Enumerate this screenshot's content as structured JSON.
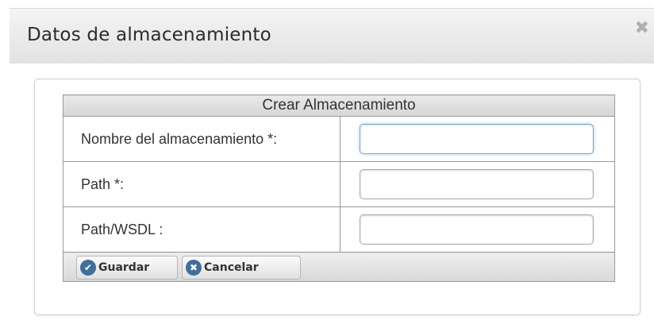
{
  "dialog": {
    "title": "Datos de almacenamiento",
    "close_glyph": "✖"
  },
  "form": {
    "header": "Crear Almacenamiento",
    "fields": [
      {
        "label": "Nombre del almacenamiento *:",
        "value": ""
      },
      {
        "label": "Path *:",
        "value": ""
      },
      {
        "label": "Path/WSDL :",
        "value": ""
      }
    ],
    "buttons": {
      "save": {
        "label": "Guardar",
        "icon": "check-circle-icon"
      },
      "cancel": {
        "label": "Cancelar",
        "icon": "x-circle-icon"
      }
    }
  },
  "colors": {
    "icon_blue": "#3f6f9a",
    "focus_blue": "#7aa7d4"
  }
}
